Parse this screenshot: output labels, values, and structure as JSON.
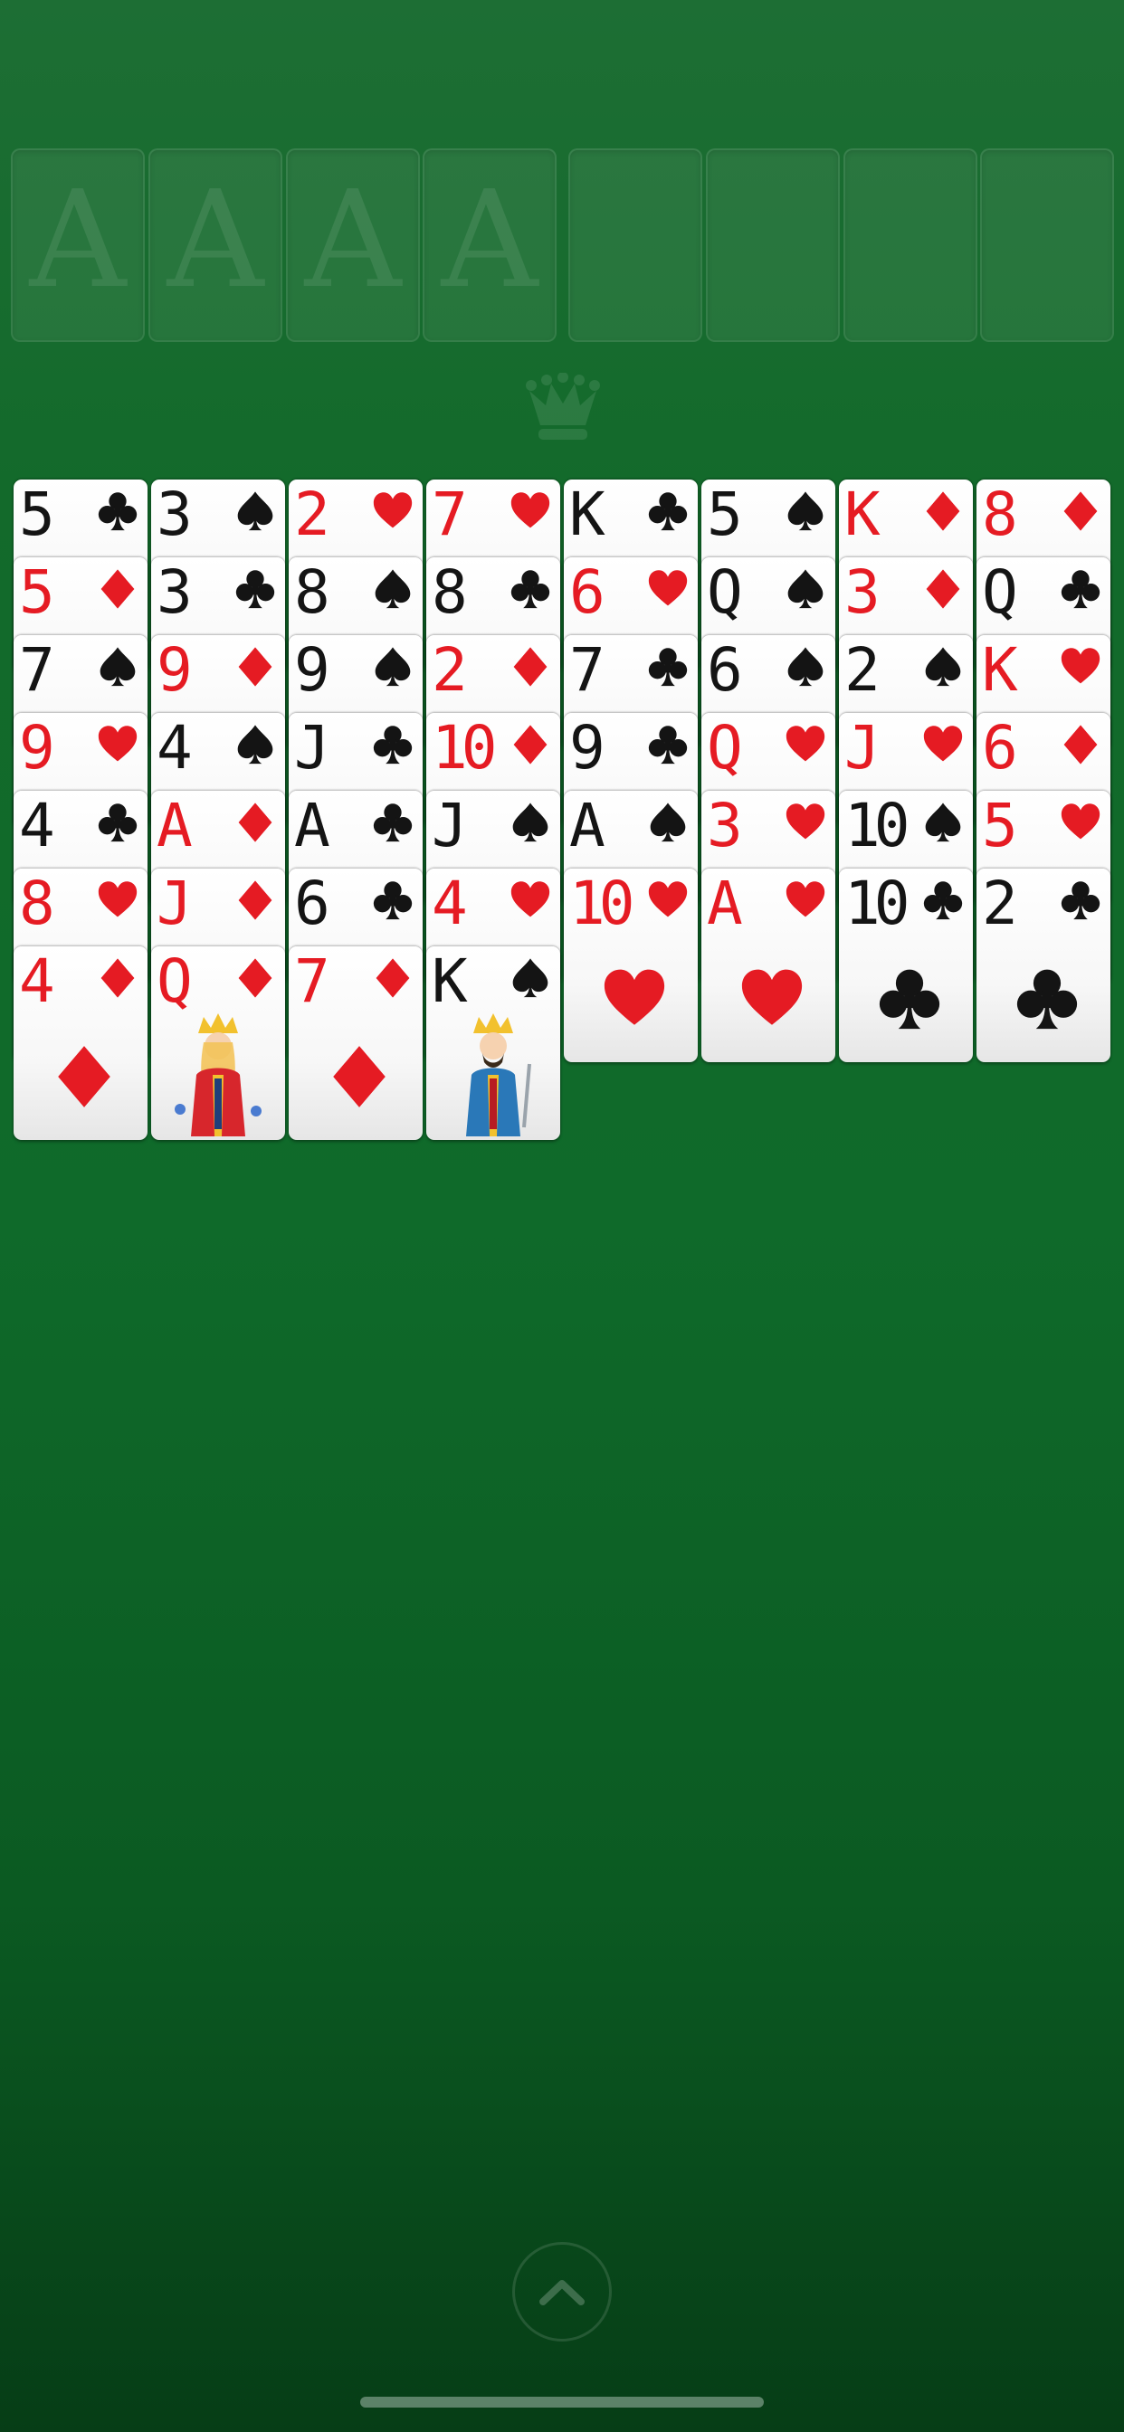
{
  "foundations": [
    {
      "label": "A"
    },
    {
      "label": "A"
    },
    {
      "label": "A"
    },
    {
      "label": "A"
    }
  ],
  "free_cells": [
    {
      "label": ""
    },
    {
      "label": ""
    },
    {
      "label": ""
    },
    {
      "label": ""
    }
  ],
  "crown_icon": "crown-icon",
  "columns": [
    [
      {
        "rank": "5",
        "suit": "clubs"
      },
      {
        "rank": "5",
        "suit": "diamonds"
      },
      {
        "rank": "7",
        "suit": "spades"
      },
      {
        "rank": "9",
        "suit": "hearts"
      },
      {
        "rank": "4",
        "suit": "clubs"
      },
      {
        "rank": "8",
        "suit": "hearts"
      },
      {
        "rank": "4",
        "suit": "diamonds"
      }
    ],
    [
      {
        "rank": "3",
        "suit": "spades"
      },
      {
        "rank": "3",
        "suit": "clubs"
      },
      {
        "rank": "9",
        "suit": "diamonds"
      },
      {
        "rank": "4",
        "suit": "spades"
      },
      {
        "rank": "A",
        "suit": "diamonds"
      },
      {
        "rank": "J",
        "suit": "diamonds"
      },
      {
        "rank": "Q",
        "suit": "diamonds"
      }
    ],
    [
      {
        "rank": "2",
        "suit": "hearts"
      },
      {
        "rank": "8",
        "suit": "spades"
      },
      {
        "rank": "9",
        "suit": "spades"
      },
      {
        "rank": "J",
        "suit": "clubs"
      },
      {
        "rank": "A",
        "suit": "clubs"
      },
      {
        "rank": "6",
        "suit": "clubs"
      },
      {
        "rank": "7",
        "suit": "diamonds"
      }
    ],
    [
      {
        "rank": "7",
        "suit": "hearts"
      },
      {
        "rank": "8",
        "suit": "clubs"
      },
      {
        "rank": "2",
        "suit": "diamonds"
      },
      {
        "rank": "10",
        "suit": "diamonds"
      },
      {
        "rank": "J",
        "suit": "spades"
      },
      {
        "rank": "4",
        "suit": "hearts"
      },
      {
        "rank": "K",
        "suit": "spades"
      }
    ],
    [
      {
        "rank": "K",
        "suit": "clubs"
      },
      {
        "rank": "6",
        "suit": "hearts"
      },
      {
        "rank": "7",
        "suit": "clubs"
      },
      {
        "rank": "9",
        "suit": "clubs"
      },
      {
        "rank": "A",
        "suit": "spades"
      },
      {
        "rank": "10",
        "suit": "hearts"
      }
    ],
    [
      {
        "rank": "5",
        "suit": "spades"
      },
      {
        "rank": "Q",
        "suit": "spades"
      },
      {
        "rank": "6",
        "suit": "spades"
      },
      {
        "rank": "Q",
        "suit": "hearts"
      },
      {
        "rank": "3",
        "suit": "hearts"
      },
      {
        "rank": "A",
        "suit": "hearts"
      }
    ],
    [
      {
        "rank": "K",
        "suit": "diamonds"
      },
      {
        "rank": "3",
        "suit": "diamonds"
      },
      {
        "rank": "2",
        "suit": "spades"
      },
      {
        "rank": "J",
        "suit": "hearts"
      },
      {
        "rank": "10",
        "suit": "spades"
      },
      {
        "rank": "10",
        "suit": "clubs"
      }
    ],
    [
      {
        "rank": "8",
        "suit": "diamonds"
      },
      {
        "rank": "Q",
        "suit": "clubs"
      },
      {
        "rank": "K",
        "suit": "hearts"
      },
      {
        "rank": "6",
        "suit": "diamonds"
      },
      {
        "rank": "5",
        "suit": "hearts"
      },
      {
        "rank": "2",
        "suit": "clubs"
      }
    ]
  ],
  "colors": {
    "red": "#e51b23",
    "black": "#141414",
    "felt": "#0f6a2a"
  },
  "bottom": {
    "expand_icon": "chevron-up-icon"
  }
}
